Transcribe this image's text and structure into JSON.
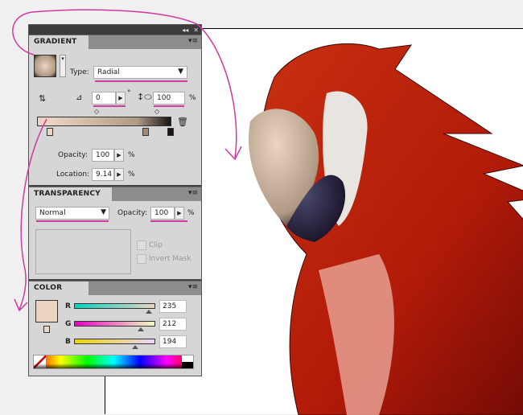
{
  "gradient": {
    "title": "GRADIENT",
    "type_label": "Type:",
    "type_value": "Radial",
    "angle": "0",
    "degree": "°",
    "aspect": "100",
    "percent": "%",
    "opacity_label": "Opacity:",
    "opacity": "100",
    "location_label": "Location:",
    "location": "9.14"
  },
  "transparency": {
    "title": "TRANSPARENCY",
    "blend_mode": "Normal",
    "opacity_label": "Opacity:",
    "opacity": "100",
    "percent": "%",
    "clip_label": "Clip",
    "invert_mask_label": "Invert Mask"
  },
  "color": {
    "title": "COLOR",
    "r_label": "R",
    "g_label": "G",
    "b_label": "B",
    "r": "235",
    "g": "212",
    "b": "194",
    "swatch": "#ebd4c2"
  },
  "topbar": {
    "collapse": "◂◂",
    "close": "✕"
  },
  "menu_icon": "▾≡"
}
